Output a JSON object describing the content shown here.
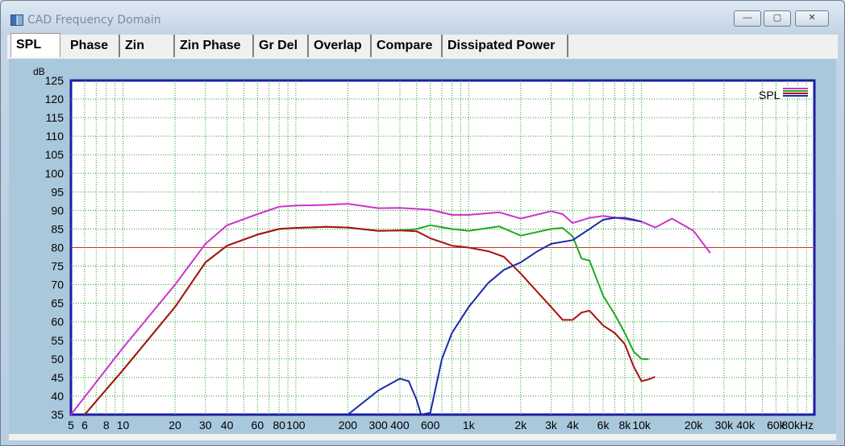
{
  "window": {
    "title": "CAD Frequency Domain",
    "minimize": "—",
    "maximize": "▢",
    "close": "✕"
  },
  "tabs": [
    {
      "label": "SPL",
      "active": true
    },
    {
      "label": "Phase",
      "active": false
    },
    {
      "label": "Zin",
      "active": false
    },
    {
      "label": "Zin Phase",
      "active": false
    },
    {
      "label": "Gr Del",
      "active": false
    },
    {
      "label": "Overlap",
      "active": false
    },
    {
      "label": "Compare",
      "active": false
    },
    {
      "label": "Dissipated Power",
      "active": false
    }
  ],
  "chart_data": {
    "type": "line",
    "ylabel": "dB",
    "ylim": [
      35,
      125
    ],
    "yticks": [
      35,
      40,
      45,
      50,
      55,
      60,
      65,
      70,
      75,
      80,
      85,
      90,
      95,
      100,
      105,
      110,
      115,
      120,
      125
    ],
    "xscale": "log",
    "xlim": [
      5,
      100000
    ],
    "xticks": [
      {
        "v": 5,
        "label": "5"
      },
      {
        "v": 6,
        "label": "6"
      },
      {
        "v": 8,
        "label": "8"
      },
      {
        "v": 10,
        "label": "10"
      },
      {
        "v": 20,
        "label": "20"
      },
      {
        "v": 30,
        "label": "30"
      },
      {
        "v": 40,
        "label": "40"
      },
      {
        "v": 60,
        "label": "60"
      },
      {
        "v": 80,
        "label": "80"
      },
      {
        "v": 100,
        "label": "100"
      },
      {
        "v": 200,
        "label": "200"
      },
      {
        "v": 300,
        "label": "300"
      },
      {
        "v": 400,
        "label": "400"
      },
      {
        "v": 600,
        "label": "600"
      },
      {
        "v": 1000,
        "label": "1k"
      },
      {
        "v": 2000,
        "label": "2k"
      },
      {
        "v": 3000,
        "label": "3k"
      },
      {
        "v": 4000,
        "label": "4k"
      },
      {
        "v": 6000,
        "label": "6k"
      },
      {
        "v": 8000,
        "label": "8k"
      },
      {
        "v": 10000,
        "label": "10k"
      },
      {
        "v": 20000,
        "label": "20k"
      },
      {
        "v": 30000,
        "label": "30k"
      },
      {
        "v": 40000,
        "label": "40k"
      },
      {
        "v": 60000,
        "label": "60k"
      },
      {
        "v": 80000,
        "label": "80kHz"
      }
    ],
    "grid": true,
    "reference_line": {
      "y": 80,
      "color": "#c0392b"
    },
    "legend": {
      "label": "SPL",
      "placement": "top-right"
    },
    "series": [
      {
        "color": "#cc33cc",
        "points": [
          [
            5,
            35
          ],
          [
            10,
            53
          ],
          [
            20,
            70
          ],
          [
            30,
            81
          ],
          [
            40,
            86
          ],
          [
            60,
            89
          ],
          [
            80,
            91
          ],
          [
            100,
            91.3
          ],
          [
            150,
            91.5
          ],
          [
            200,
            91.8
          ],
          [
            300,
            90.6
          ],
          [
            400,
            90.7
          ],
          [
            600,
            90.2
          ],
          [
            800,
            88.8
          ],
          [
            1000,
            88.8
          ],
          [
            1500,
            89.5
          ],
          [
            2000,
            87.8
          ],
          [
            3000,
            89.8
          ],
          [
            3500,
            89
          ],
          [
            4000,
            86.6
          ],
          [
            5000,
            88
          ],
          [
            6000,
            88.5
          ],
          [
            8000,
            87.7
          ],
          [
            10000,
            87
          ],
          [
            12000,
            85.4
          ],
          [
            15000,
            87.8
          ],
          [
            20000,
            84.5
          ],
          [
            25000,
            78.5
          ]
        ]
      },
      {
        "color": "#22a822",
        "points": [
          [
            6,
            35
          ],
          [
            10,
            47
          ],
          [
            20,
            64
          ],
          [
            30,
            76
          ],
          [
            40,
            80.5
          ],
          [
            60,
            83.5
          ],
          [
            80,
            85
          ],
          [
            100,
            85.3
          ],
          [
            150,
            85.6
          ],
          [
            200,
            85.4
          ],
          [
            300,
            84.5
          ],
          [
            400,
            84.6
          ],
          [
            500,
            85
          ],
          [
            600,
            86
          ],
          [
            800,
            85
          ],
          [
            1000,
            84.5
          ],
          [
            1500,
            85.7
          ],
          [
            2000,
            83.2
          ],
          [
            3000,
            85
          ],
          [
            3500,
            85.3
          ],
          [
            4000,
            83
          ],
          [
            4500,
            77
          ],
          [
            5000,
            76.5
          ],
          [
            6000,
            67
          ],
          [
            7000,
            62
          ],
          [
            8000,
            57
          ],
          [
            9000,
            52
          ],
          [
            10000,
            50
          ],
          [
            11000,
            49.9
          ]
        ]
      },
      {
        "color": "#aa1111",
        "points": [
          [
            6,
            35
          ],
          [
            10,
            47
          ],
          [
            20,
            64
          ],
          [
            30,
            76
          ],
          [
            40,
            80.5
          ],
          [
            60,
            83.5
          ],
          [
            80,
            85
          ],
          [
            100,
            85.3
          ],
          [
            150,
            85.6
          ],
          [
            200,
            85.4
          ],
          [
            300,
            84.5
          ],
          [
            400,
            84.6
          ],
          [
            500,
            84.4
          ],
          [
            600,
            82.5
          ],
          [
            800,
            80.5
          ],
          [
            1000,
            80
          ],
          [
            1300,
            79
          ],
          [
            1600,
            77.5
          ],
          [
            2000,
            73
          ],
          [
            2500,
            68
          ],
          [
            3000,
            64
          ],
          [
            3500,
            60.5
          ],
          [
            4000,
            60.5
          ],
          [
            4500,
            62.5
          ],
          [
            5000,
            63
          ],
          [
            6000,
            59
          ],
          [
            7000,
            57
          ],
          [
            8000,
            54
          ],
          [
            9000,
            48
          ],
          [
            10000,
            44
          ],
          [
            11000,
            44.5
          ],
          [
            12000,
            45.2
          ]
        ]
      },
      {
        "color": "#1a2aa8",
        "points": [
          [
            200,
            35
          ],
          [
            300,
            41.5
          ],
          [
            400,
            44.7
          ],
          [
            450,
            44
          ],
          [
            500,
            39
          ],
          [
            530,
            35
          ],
          [
            600,
            35.5
          ],
          [
            700,
            50
          ],
          [
            800,
            57
          ],
          [
            1000,
            64
          ],
          [
            1300,
            70.5
          ],
          [
            1600,
            74
          ],
          [
            2000,
            76
          ],
          [
            2500,
            79
          ],
          [
            3000,
            81
          ],
          [
            4000,
            82
          ],
          [
            5000,
            85
          ],
          [
            6000,
            87.5
          ],
          [
            7000,
            88
          ],
          [
            8000,
            88
          ],
          [
            9000,
            87.5
          ],
          [
            10000,
            87
          ]
        ]
      }
    ]
  }
}
